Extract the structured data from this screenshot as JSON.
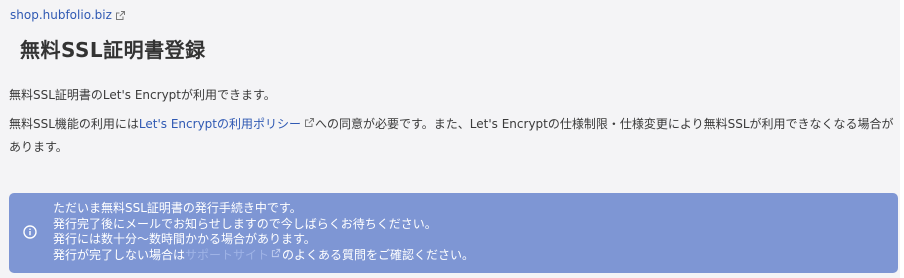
{
  "site": {
    "domain": "shop.hubfolio.biz"
  },
  "page": {
    "title": "無料SSL証明書登録"
  },
  "intro": {
    "line1": "無料SSL証明書のLet's Encryptが利用できます。"
  },
  "policy": {
    "before": "無料SSL機能の利用には",
    "link": "Let's Encryptの利用ポリシー",
    "after": "への同意が必要です。また、Let's Encryptの仕様制限・仕様変更により無料SSLが利用できなくなる場合があります。"
  },
  "notice": {
    "line1": "ただいま無料SSL証明書の発行手続き中です。",
    "line2": "発行完了後にメールでお知らせしますので今しばらくお待ちください。",
    "line3": "発行には数十分〜数時間かかる場合があります。",
    "line4_before": "発行が完了しない場合は",
    "line4_link": "サポートサイト",
    "line4_after": "のよくある質問をご確認ください。"
  },
  "icons": {
    "external": "external-link-icon",
    "info": "info-circle-icon"
  },
  "colors": {
    "link": "#2f59b3",
    "notice_bg": "#7e96d4",
    "panel_bg": "#f4f4f6"
  }
}
